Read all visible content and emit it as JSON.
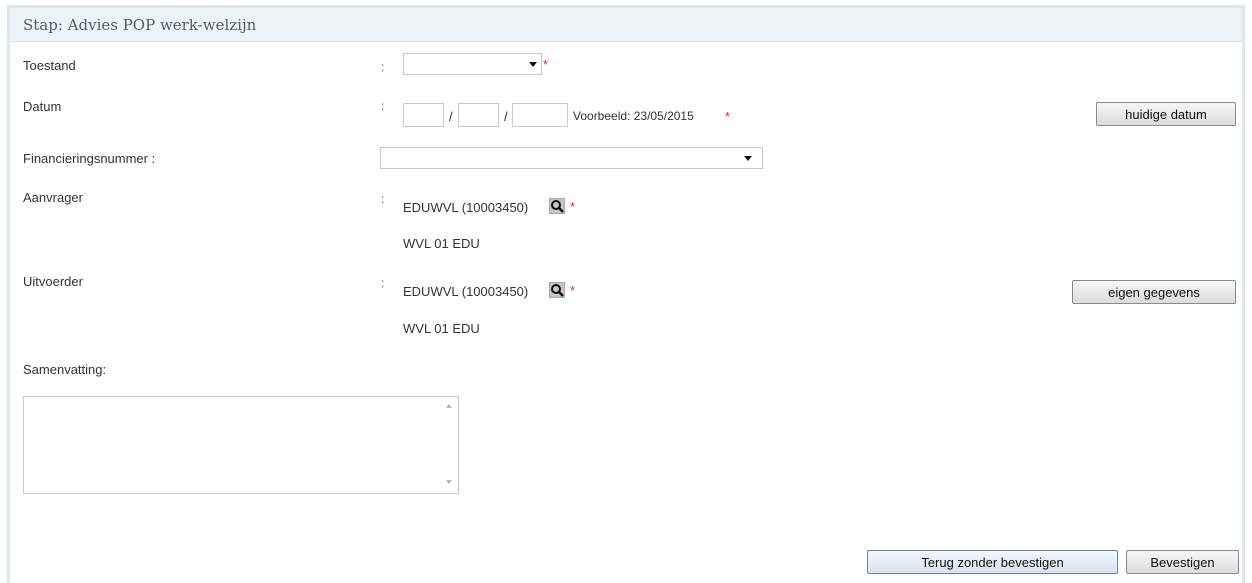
{
  "panel": {
    "title": "Stap: Advies POP werk-welzijn"
  },
  "colon": ":",
  "required_mark": "*",
  "slash": "/",
  "form": {
    "toestand": {
      "label": "Toestand",
      "value": ""
    },
    "datum": {
      "label": "Datum",
      "day": "",
      "month": "",
      "year": "",
      "example": "Voorbeeld: 23/05/2015",
      "today_button": "huidige datum"
    },
    "financiering": {
      "label": "Financieringsnummer :",
      "value": ""
    },
    "aanvrager": {
      "label": "Aanvrager",
      "value": "EDUWVL (10003450)",
      "name": "WVL 01 EDU"
    },
    "uitvoerder": {
      "label": "Uitvoerder",
      "value": "EDUWVL (10003450)",
      "name": "WVL 01 EDU",
      "own_button": "eigen gegevens"
    },
    "samenvatting": {
      "label": "Samenvatting:",
      "value": ""
    }
  },
  "footer": {
    "back_button": "Terug zonder bevestigen",
    "confirm_button": "Bevestigen"
  },
  "icons": {
    "lookup": "magnifier-icon",
    "dropdown": "caret-down-icon"
  },
  "colors": {
    "header_bg": "#eef3f5",
    "title": "#4a5d72",
    "required": "#e3242b",
    "panel_border": "#dde7ec"
  }
}
